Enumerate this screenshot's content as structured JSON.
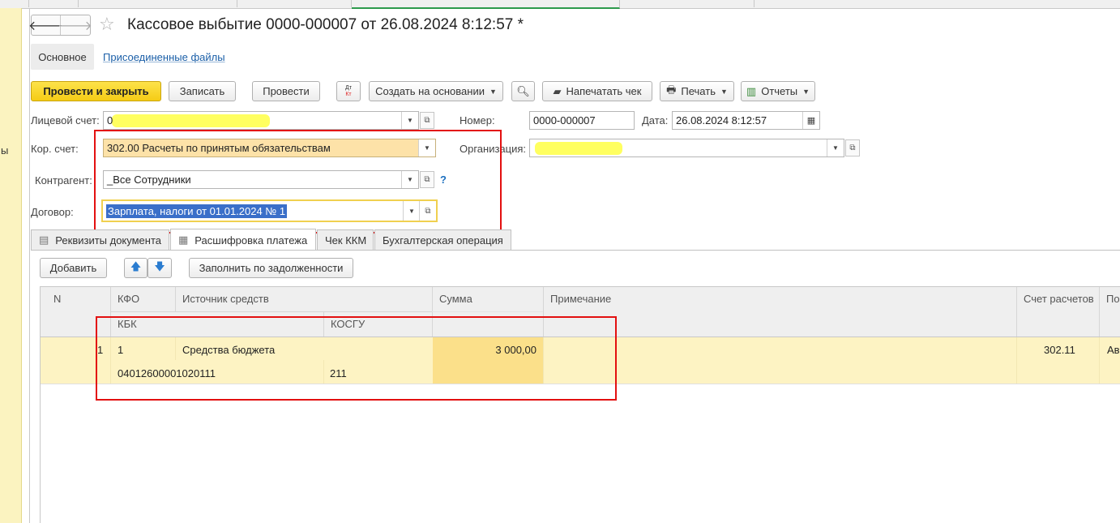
{
  "window": {
    "title": "Кассовое выбытие 0000-000007 от 26.08.2024 8:12:57 *",
    "left_panel_fragment": "ы"
  },
  "form_tabs": {
    "main": "Основное",
    "files": "Присоединенные файлы"
  },
  "toolbar": {
    "post_close": "Провести и закрыть",
    "save": "Записать",
    "post": "Провести",
    "dt_kt_top": "Дт",
    "dt_kt_bottom": "Кт",
    "create_based": "Создать на основании",
    "print_check": "Напечатать чек",
    "print": "Печать",
    "reports": "Отчеты"
  },
  "fields": {
    "account_label": "Лицевой счет:",
    "account_value": "0",
    "number_label": "Номер:",
    "number_value": "0000-000007",
    "date_label": "Дата:",
    "date_value": "26.08.2024  8:12:57",
    "kor_label": "Кор. счет:",
    "kor_value": "302.00 Расчеты по принятым обязательствам",
    "org_label": "Организация:",
    "org_value": "",
    "contractor_label": "Контрагент:",
    "contractor_value": "_Все Сотрудники",
    "help_mark": "?",
    "contract_label": "Договор:",
    "contract_value": "Зарплата, налоги от 01.01.2024 № 1"
  },
  "doc_tabs": [
    "Реквизиты документа",
    "Расшифровка платежа",
    "Чек ККМ",
    "Бухгалтерская операция"
  ],
  "table_toolbar": {
    "add": "Добавить",
    "fill": "Заполнить по задолженности"
  },
  "table": {
    "headers": {
      "n": "N",
      "kfo": "КФО",
      "source": "Источник средств",
      "sum": "Сумма",
      "note": "Примечание",
      "account": "Счет расчетов",
      "po": "По",
      "kbk": "КБК",
      "kosgu": "КОСГУ"
    },
    "rows": [
      {
        "n": "1",
        "kfo": "1",
        "source": "Средства бюджета",
        "sum": "3 000,00",
        "note": "",
        "account": "302.11",
        "po": "Ав",
        "kbk": "04012600001020111",
        "kosgu": "211"
      }
    ]
  },
  "colors": {
    "primary_button": "#f5cc15",
    "highlight_row": "#fdf3c3",
    "sum_cell": "#fbe08a",
    "annotation": "#e31010"
  }
}
